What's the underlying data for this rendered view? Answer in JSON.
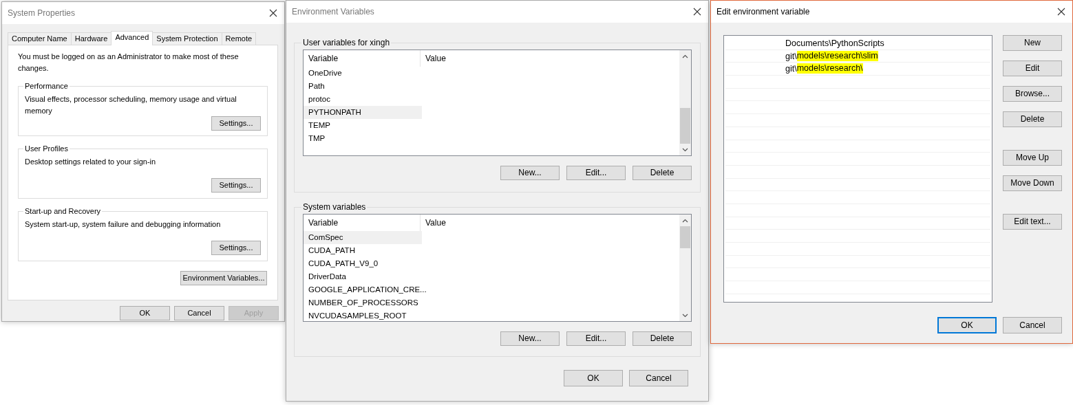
{
  "system_properties": {
    "title": "System Properties",
    "tabs": [
      {
        "label": "Computer Name",
        "selected": false
      },
      {
        "label": "Hardware",
        "selected": false
      },
      {
        "label": "Advanced",
        "selected": true
      },
      {
        "label": "System Protection",
        "selected": false
      },
      {
        "label": "Remote",
        "selected": false
      }
    ],
    "notice": "You must be logged on as an Administrator to make most of these changes.",
    "groups": [
      {
        "title": "Performance",
        "description": "Visual effects, processor scheduling, memory usage and virtual memory",
        "button": "Settings..."
      },
      {
        "title": "User Profiles",
        "description": "Desktop settings related to your sign-in",
        "button": "Settings..."
      },
      {
        "title": "Start-up and Recovery",
        "description": "System start-up, system failure and debugging information",
        "button": "Settings..."
      }
    ],
    "env_button": "Environment Variables...",
    "buttons": [
      {
        "label": "OK",
        "disabled": false
      },
      {
        "label": "Cancel",
        "disabled": false
      },
      {
        "label": "Apply",
        "disabled": true
      }
    ]
  },
  "environment_variables": {
    "title": "Environment Variables",
    "sections": [
      {
        "title": "User variables for xingh",
        "columns": [
          "Variable",
          "Value"
        ],
        "rows": [
          {
            "variable": "OneDrive",
            "selected": false
          },
          {
            "variable": "Path",
            "selected": false
          },
          {
            "variable": "protoc",
            "selected": false
          },
          {
            "variable": "PYTHONPATH",
            "selected": true
          },
          {
            "variable": "TEMP",
            "selected": false
          },
          {
            "variable": "TMP",
            "selected": false
          }
        ],
        "buttons": [
          "New...",
          "Edit...",
          "Delete"
        ]
      },
      {
        "title": "System variables",
        "columns": [
          "Variable",
          "Value"
        ],
        "rows": [
          {
            "variable": "ComSpec",
            "selected": true
          },
          {
            "variable": "CUDA_PATH",
            "selected": false
          },
          {
            "variable": "CUDA_PATH_V9_0",
            "selected": false
          },
          {
            "variable": "DriverData",
            "selected": false
          },
          {
            "variable": "GOOGLE_APPLICATION_CRE...",
            "selected": false
          },
          {
            "variable": "NUMBER_OF_PROCESSORS",
            "selected": false
          },
          {
            "variable": "NVCUDASAMPLES_ROOT",
            "selected": false
          }
        ],
        "buttons": [
          "New...",
          "Edit...",
          "Delete"
        ]
      }
    ],
    "buttons": [
      "OK",
      "Cancel"
    ]
  },
  "edit_variable": {
    "title": "Edit environment variable",
    "entries": [
      {
        "text": "Documents\\PythonScripts"
      },
      {
        "text": "git\\",
        "highlight": "models\\research\\slim"
      },
      {
        "text": "git\\",
        "highlight": "models\\research\\"
      }
    ],
    "side_button_groups": [
      [
        "New",
        "Edit",
        "Browse...",
        "Delete"
      ],
      [
        "Move Up",
        "Move Down"
      ],
      [
        "Edit text..."
      ]
    ],
    "buttons": [
      {
        "label": "OK",
        "focused": true
      },
      {
        "label": "Cancel",
        "focused": false
      }
    ]
  }
}
